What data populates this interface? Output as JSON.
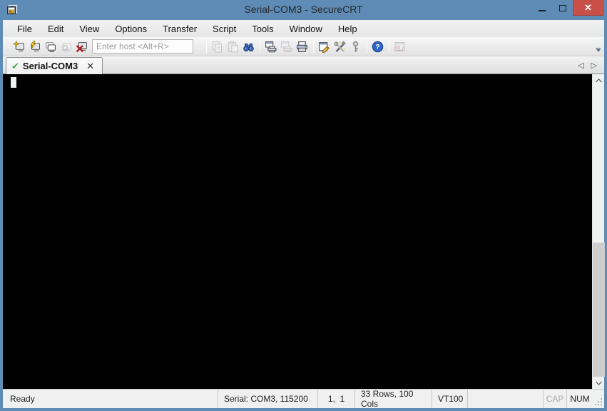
{
  "window": {
    "title": "Serial-COM3 - SecureCRT"
  },
  "menu": {
    "items": [
      "File",
      "Edit",
      "View",
      "Options",
      "Transfer",
      "Script",
      "Tools",
      "Window",
      "Help"
    ]
  },
  "toolbar": {
    "host_input": {
      "placeholder": "Enter host <Alt+R>",
      "value": ""
    },
    "icons": [
      {
        "name": "connect-dialog-icon",
        "enabled": true
      },
      {
        "name": "quick-connect-icon",
        "enabled": true
      },
      {
        "name": "connect-in-tab-icon",
        "enabled": true
      },
      {
        "name": "reconnect-icon",
        "enabled": false
      },
      {
        "name": "disconnect-icon",
        "enabled": true
      },
      {
        "name": "copy-icon",
        "enabled": false
      },
      {
        "name": "paste-icon",
        "enabled": false
      },
      {
        "name": "find-icon",
        "enabled": true
      },
      {
        "name": "print-screen-icon",
        "enabled": true
      },
      {
        "name": "print-selection-icon",
        "enabled": false
      },
      {
        "name": "print-icon",
        "enabled": true
      },
      {
        "name": "session-options-icon",
        "enabled": true
      },
      {
        "name": "global-options-icon",
        "enabled": true
      },
      {
        "name": "key-generator-icon",
        "enabled": true
      },
      {
        "name": "help-icon",
        "enabled": true
      },
      {
        "name": "chat-window-icon",
        "enabled": false
      }
    ]
  },
  "tabs": {
    "items": [
      {
        "label": "Serial-COM3",
        "check_glyph": "✔",
        "close_glyph": "✕",
        "status": "connected"
      }
    ],
    "scroll_left_glyph": "◁",
    "scroll_right_glyph": "▷"
  },
  "status_bar": {
    "ready": "Ready",
    "connection": "Serial: COM3, 115200",
    "cursor_position": "1,  1",
    "terminal_size": "33 Rows, 100 Cols",
    "emulation": "VT100",
    "caps_lock": "CAP",
    "num_lock": "NUM"
  },
  "colors": {
    "titlebar": "#5e8cb7",
    "close_button": "#c85048",
    "tab_check_green": "#3fae49",
    "terminal_background": "#000000",
    "terminal_cursor": "#f2f2f2",
    "statusbar_background": "#f0f0f0"
  }
}
